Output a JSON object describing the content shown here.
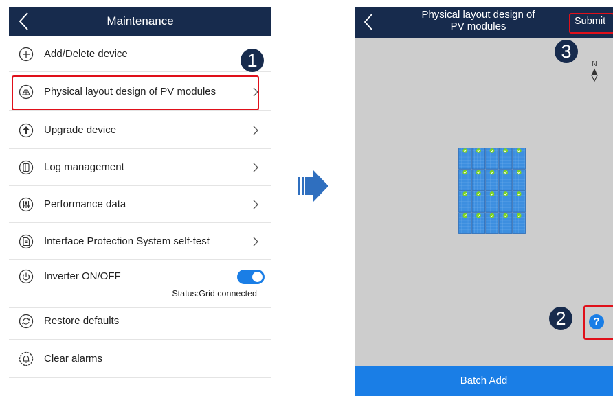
{
  "left_screen": {
    "header": {
      "title": "Maintenance"
    },
    "menu": [
      {
        "label": "Add/Delete device",
        "icon": "plus-circle-icon"
      },
      {
        "label": "Physical layout design of PV modules",
        "icon": "layout-icon"
      },
      {
        "label": "Upgrade device",
        "icon": "upgrade-arrow-icon"
      },
      {
        "label": "Log management",
        "icon": "log-icon"
      },
      {
        "label": "Performance data",
        "icon": "sliders-icon"
      },
      {
        "label": "Interface Protection System self-test",
        "icon": "document-check-icon"
      },
      {
        "label": "Inverter ON/OFF",
        "icon": "power-icon",
        "toggle_on": true,
        "status": "Status:Grid connected"
      },
      {
        "label": "Restore defaults",
        "icon": "restore-icon"
      },
      {
        "label": "Clear alarms",
        "icon": "alarm-bell-icon"
      }
    ]
  },
  "right_screen": {
    "header": {
      "title_line1": "Physical layout design of",
      "title_line2": "PV modules",
      "submit_label": "Submit"
    },
    "compass_label": "N",
    "help_label": "?",
    "footer": {
      "batch_add_label": "Batch Add"
    },
    "panel_grid": {
      "rows": 4,
      "columns": 5
    }
  },
  "steps": {
    "step1": "1",
    "step2": "2",
    "step3": "3"
  },
  "colors": {
    "header": "#172b4d",
    "accent": "#1a7ee6",
    "highlight": "#e0101a",
    "panel": "#3d8fe0",
    "check": "#7dd321"
  }
}
